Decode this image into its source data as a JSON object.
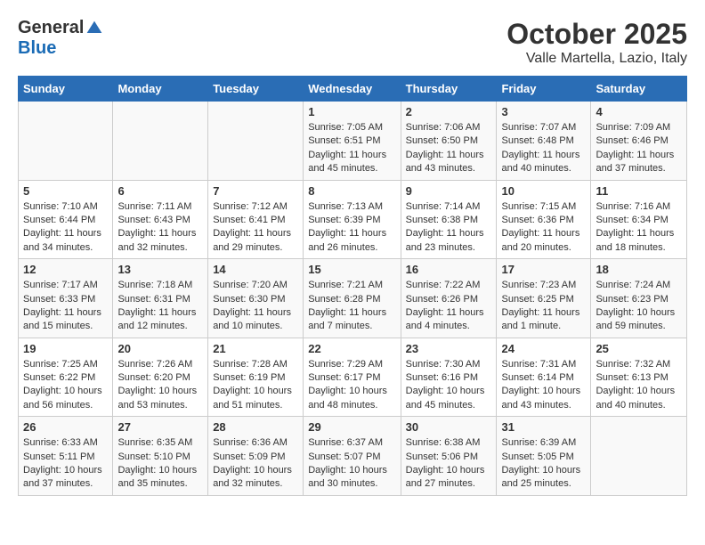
{
  "header": {
    "logo_general": "General",
    "logo_blue": "Blue",
    "month_title": "October 2025",
    "location": "Valle Martella, Lazio, Italy"
  },
  "days_of_week": [
    "Sunday",
    "Monday",
    "Tuesday",
    "Wednesday",
    "Thursday",
    "Friday",
    "Saturday"
  ],
  "weeks": [
    [
      {
        "day": "",
        "info": ""
      },
      {
        "day": "",
        "info": ""
      },
      {
        "day": "",
        "info": ""
      },
      {
        "day": "1",
        "info": "Sunrise: 7:05 AM\nSunset: 6:51 PM\nDaylight: 11 hours and 45 minutes."
      },
      {
        "day": "2",
        "info": "Sunrise: 7:06 AM\nSunset: 6:50 PM\nDaylight: 11 hours and 43 minutes."
      },
      {
        "day": "3",
        "info": "Sunrise: 7:07 AM\nSunset: 6:48 PM\nDaylight: 11 hours and 40 minutes."
      },
      {
        "day": "4",
        "info": "Sunrise: 7:09 AM\nSunset: 6:46 PM\nDaylight: 11 hours and 37 minutes."
      }
    ],
    [
      {
        "day": "5",
        "info": "Sunrise: 7:10 AM\nSunset: 6:44 PM\nDaylight: 11 hours and 34 minutes."
      },
      {
        "day": "6",
        "info": "Sunrise: 7:11 AM\nSunset: 6:43 PM\nDaylight: 11 hours and 32 minutes."
      },
      {
        "day": "7",
        "info": "Sunrise: 7:12 AM\nSunset: 6:41 PM\nDaylight: 11 hours and 29 minutes."
      },
      {
        "day": "8",
        "info": "Sunrise: 7:13 AM\nSunset: 6:39 PM\nDaylight: 11 hours and 26 minutes."
      },
      {
        "day": "9",
        "info": "Sunrise: 7:14 AM\nSunset: 6:38 PM\nDaylight: 11 hours and 23 minutes."
      },
      {
        "day": "10",
        "info": "Sunrise: 7:15 AM\nSunset: 6:36 PM\nDaylight: 11 hours and 20 minutes."
      },
      {
        "day": "11",
        "info": "Sunrise: 7:16 AM\nSunset: 6:34 PM\nDaylight: 11 hours and 18 minutes."
      }
    ],
    [
      {
        "day": "12",
        "info": "Sunrise: 7:17 AM\nSunset: 6:33 PM\nDaylight: 11 hours and 15 minutes."
      },
      {
        "day": "13",
        "info": "Sunrise: 7:18 AM\nSunset: 6:31 PM\nDaylight: 11 hours and 12 minutes."
      },
      {
        "day": "14",
        "info": "Sunrise: 7:20 AM\nSunset: 6:30 PM\nDaylight: 11 hours and 10 minutes."
      },
      {
        "day": "15",
        "info": "Sunrise: 7:21 AM\nSunset: 6:28 PM\nDaylight: 11 hours and 7 minutes."
      },
      {
        "day": "16",
        "info": "Sunrise: 7:22 AM\nSunset: 6:26 PM\nDaylight: 11 hours and 4 minutes."
      },
      {
        "day": "17",
        "info": "Sunrise: 7:23 AM\nSunset: 6:25 PM\nDaylight: 11 hours and 1 minute."
      },
      {
        "day": "18",
        "info": "Sunrise: 7:24 AM\nSunset: 6:23 PM\nDaylight: 10 hours and 59 minutes."
      }
    ],
    [
      {
        "day": "19",
        "info": "Sunrise: 7:25 AM\nSunset: 6:22 PM\nDaylight: 10 hours and 56 minutes."
      },
      {
        "day": "20",
        "info": "Sunrise: 7:26 AM\nSunset: 6:20 PM\nDaylight: 10 hours and 53 minutes."
      },
      {
        "day": "21",
        "info": "Sunrise: 7:28 AM\nSunset: 6:19 PM\nDaylight: 10 hours and 51 minutes."
      },
      {
        "day": "22",
        "info": "Sunrise: 7:29 AM\nSunset: 6:17 PM\nDaylight: 10 hours and 48 minutes."
      },
      {
        "day": "23",
        "info": "Sunrise: 7:30 AM\nSunset: 6:16 PM\nDaylight: 10 hours and 45 minutes."
      },
      {
        "day": "24",
        "info": "Sunrise: 7:31 AM\nSunset: 6:14 PM\nDaylight: 10 hours and 43 minutes."
      },
      {
        "day": "25",
        "info": "Sunrise: 7:32 AM\nSunset: 6:13 PM\nDaylight: 10 hours and 40 minutes."
      }
    ],
    [
      {
        "day": "26",
        "info": "Sunrise: 6:33 AM\nSunset: 5:11 PM\nDaylight: 10 hours and 37 minutes."
      },
      {
        "day": "27",
        "info": "Sunrise: 6:35 AM\nSunset: 5:10 PM\nDaylight: 10 hours and 35 minutes."
      },
      {
        "day": "28",
        "info": "Sunrise: 6:36 AM\nSunset: 5:09 PM\nDaylight: 10 hours and 32 minutes."
      },
      {
        "day": "29",
        "info": "Sunrise: 6:37 AM\nSunset: 5:07 PM\nDaylight: 10 hours and 30 minutes."
      },
      {
        "day": "30",
        "info": "Sunrise: 6:38 AM\nSunset: 5:06 PM\nDaylight: 10 hours and 27 minutes."
      },
      {
        "day": "31",
        "info": "Sunrise: 6:39 AM\nSunset: 5:05 PM\nDaylight: 10 hours and 25 minutes."
      },
      {
        "day": "",
        "info": ""
      }
    ]
  ]
}
